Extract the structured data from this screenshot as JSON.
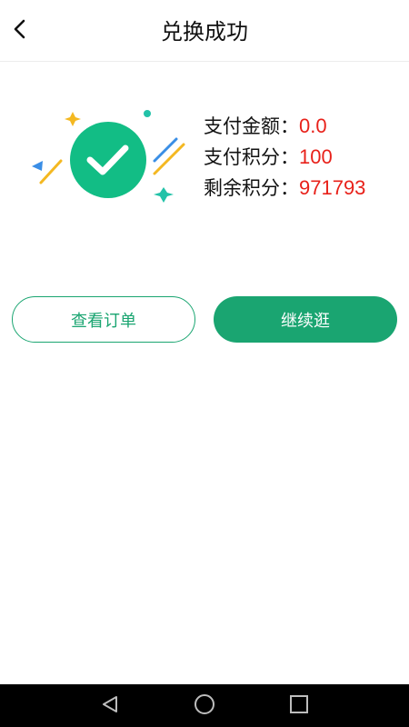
{
  "header": {
    "title": "兑换成功",
    "back_icon": "chevron-left-icon"
  },
  "illustration": {
    "icon": "checkmark-circle-icon",
    "accent_color": "#1aa571"
  },
  "info": {
    "rows": [
      {
        "label": "支付金额：",
        "value": "0.0"
      },
      {
        "label": "支付积分：",
        "value": "100"
      },
      {
        "label": "剩余积分：",
        "value": "971793"
      }
    ]
  },
  "buttons": {
    "view_orders": "查看订单",
    "continue_shopping": "继续逛"
  },
  "navbar": {
    "icons": [
      "back-triangle-icon",
      "home-circle-icon",
      "recents-square-icon"
    ]
  },
  "colors": {
    "primary": "#1aa571",
    "value_red": "#e8211a",
    "navbar": "#000000"
  }
}
